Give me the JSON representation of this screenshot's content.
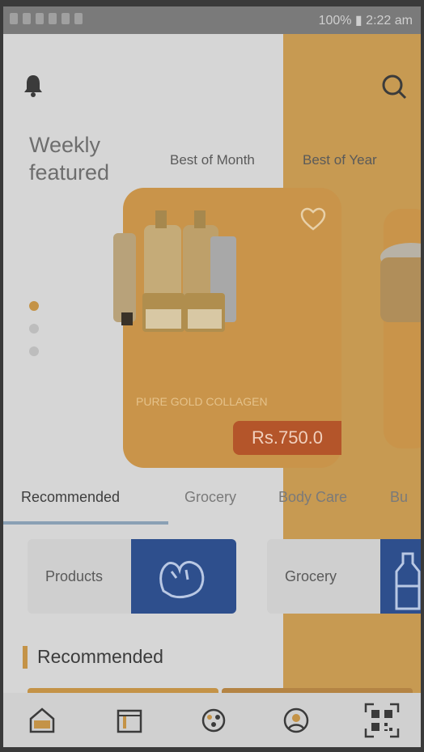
{
  "status_bar": {
    "right_text": "100% ▮ 2:22 am"
  },
  "header": {
    "weekly_line1": "Weekly",
    "weekly_line2": "featured",
    "tabs": [
      "Best of Month",
      "Best of Year"
    ]
  },
  "featured_card": {
    "label": "PURE GOLD COLLAGEN",
    "price": "Rs.750.0"
  },
  "category_tabs": [
    "Recommended",
    "Grocery",
    "Body Care",
    "Bu"
  ],
  "tiles": [
    {
      "label": "Products"
    },
    {
      "label": "Grocery"
    }
  ],
  "section": {
    "title": "Recommended"
  },
  "icons": {
    "bell": "bell-icon",
    "search": "search-icon",
    "heart": "heart-icon",
    "nav": [
      "home-icon",
      "orders-icon",
      "categories-icon",
      "profile-icon",
      "qr-code-icon"
    ]
  },
  "colors": {
    "accent": "#c9944a",
    "price_badge": "#b4552a",
    "tile_blue": "#2e4f8d"
  }
}
